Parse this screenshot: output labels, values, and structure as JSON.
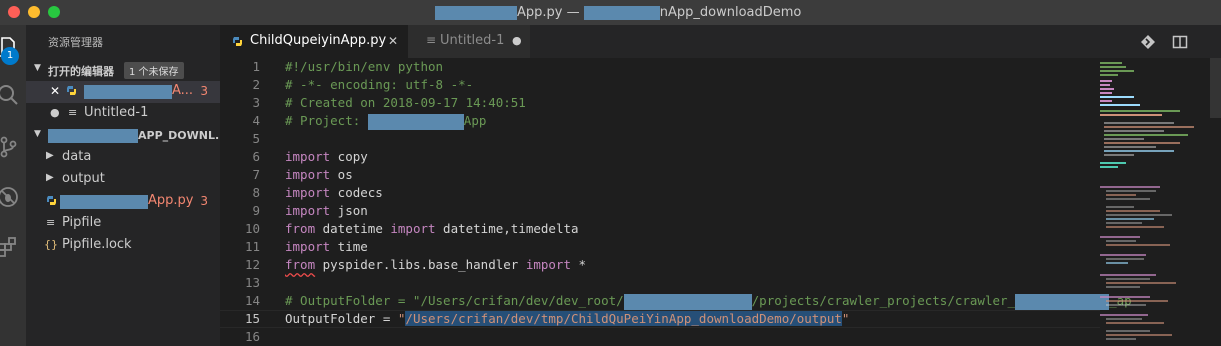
{
  "window": {
    "title_suffix_1": "App.py — ",
    "title_suffix_2": "nApp_downloadDemo"
  },
  "activity_bar": {
    "explorer_badge": "1"
  },
  "sidebar": {
    "title": "资源管理器",
    "open_editors": {
      "header": "打开的编辑器",
      "unsaved_badge": "1 个未保存",
      "items": [
        {
          "close_glyph": "✕",
          "label_suffix": "A...",
          "problems": "3"
        },
        {
          "dirty_glyph": "●",
          "label": "Untitled-1"
        }
      ]
    },
    "project": {
      "header_suffix": "APP_DOWNL..."
    },
    "tree": [
      {
        "label": "data",
        "kind": "folder"
      },
      {
        "label": "output",
        "kind": "folder"
      },
      {
        "label_suffix": "App.py",
        "kind": "python",
        "problems": "3"
      },
      {
        "label": "Pipfile",
        "kind": "file"
      },
      {
        "label": "Pipfile.lock",
        "kind": "json"
      }
    ]
  },
  "tabs": [
    {
      "label": "ChildQupeiyinApp.py",
      "close_glyph": "✕",
      "active": true
    },
    {
      "label": "Untitled-1",
      "dirty_glyph": "●",
      "active": false
    }
  ],
  "editor": {
    "current_line": 15,
    "line_numbers": [
      "1",
      "2",
      "3",
      "4",
      "5",
      "6",
      "7",
      "8",
      "9",
      "10",
      "11",
      "12",
      "13",
      "14",
      "15",
      "16"
    ],
    "code": {
      "l1": "#!/usr/bin/env python",
      "l2": "# -*- encoding: utf-8 -*-",
      "l3": "# Created on 2018-09-17 14:40:51",
      "l4_prefix": "# Project: ",
      "l4_suffix": "App",
      "kw_import": "import",
      "kw_from": "from",
      "l6_mod": " copy",
      "l7_mod": " os",
      "l8_mod": " codecs",
      "l9_mod": " json",
      "l10_mod": " datetime ",
      "l10_names": " datetime,timedelta",
      "l11_mod": " time",
      "l12_mod": " pyspider.libs.base_handler ",
      "l12_names": " *",
      "l14_prefix": "# OutputFolder = \"/Users/crifan/dev/dev_root/",
      "l14_mid": "/projects/crawler_projects/crawler_",
      "l14_suffix": "_ap",
      "l15_var": "OutputFolder = ",
      "l15_quote": "\"",
      "l15_path": "/Users/crifan/dev/tmp/ChildQuPeiYinApp_downloadDemo/output"
    }
  },
  "colors": {
    "accent": "#007acc",
    "error": "#f48771",
    "comment": "#6a9955",
    "keyword": "#c586c0",
    "string": "#ce9178"
  },
  "icons": {
    "activity": [
      "files-icon",
      "search-icon",
      "source-control-icon",
      "debug-icon",
      "extensions-icon"
    ],
    "editor_actions": [
      "git-compare-icon",
      "split-editor-icon"
    ]
  }
}
